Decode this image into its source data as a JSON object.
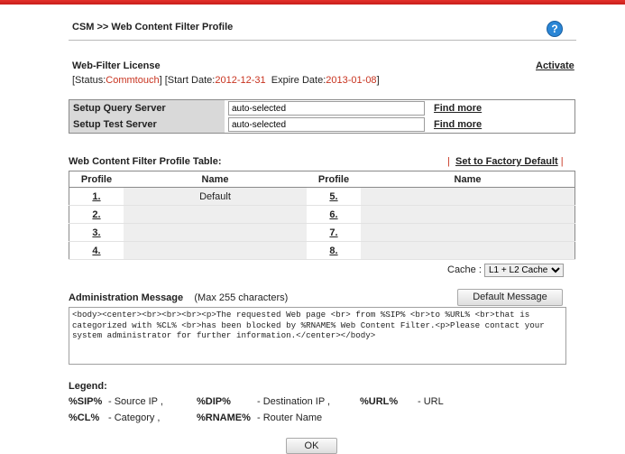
{
  "header": {
    "breadcrumb": "CSM >> Web Content Filter Profile",
    "help_icon": "question-circle-icon",
    "help_glyph": "?"
  },
  "license": {
    "title": "Web-Filter License",
    "activate_label": "Activate",
    "status_prefix": "[Status:",
    "status_value": "Commtouch",
    "start_prefix": "] [Start Date:",
    "start_value": "2012-12-31",
    "expire_prefix": "Expire Date:",
    "expire_value": "2013-01-08",
    "suffix": "]"
  },
  "servers": [
    {
      "label": "Setup Query Server",
      "value": "auto-selected",
      "link": "Find more"
    },
    {
      "label": "Setup Test Server",
      "value": "auto-selected",
      "link": "Find more"
    }
  ],
  "profile_table": {
    "title": "Web Content Filter Profile Table:",
    "factory_default_label": "Set to Factory Default",
    "separator": "|",
    "headers": [
      "Profile",
      "Name",
      "Profile",
      "Name"
    ],
    "rows": [
      {
        "left_num": "1.",
        "left_name": "Default",
        "right_num": "5.",
        "right_name": ""
      },
      {
        "left_num": "2.",
        "left_name": "",
        "right_num": "6.",
        "right_name": ""
      },
      {
        "left_num": "3.",
        "left_name": "",
        "right_num": "7.",
        "right_name": ""
      },
      {
        "left_num": "4.",
        "left_name": "",
        "right_num": "8.",
        "right_name": ""
      }
    ]
  },
  "cache": {
    "label": "Cache :",
    "selected": "L1 + L2 Cache"
  },
  "admin_message": {
    "title": "Administration Message",
    "hint": "(Max 255 characters)",
    "default_button": "Default Message",
    "text": "<body><center><br><br><br><p>The requested Web page <br> from %SIP% <br>to %URL% <br>that is categorized with %CL% <br>has been blocked by %RNAME% Web Content Filter.<p>Please contact your system administrator for further information.</center></body>"
  },
  "legend": {
    "title": "Legend:",
    "items": [
      {
        "code": "%SIP%",
        "desc": "- Source IP ,"
      },
      {
        "code": "%DIP%",
        "desc": "- Destination IP ,"
      },
      {
        "code": "%URL%",
        "desc": "- URL"
      },
      {
        "code": "%CL%",
        "desc": "- Category ,"
      },
      {
        "code": "%RNAME%",
        "desc": "- Router Name"
      }
    ]
  },
  "ok_label": "OK",
  "colors": {
    "accent_red": "#c8331f",
    "top_bar": "#d9261f",
    "help_blue": "#2a86d6"
  }
}
